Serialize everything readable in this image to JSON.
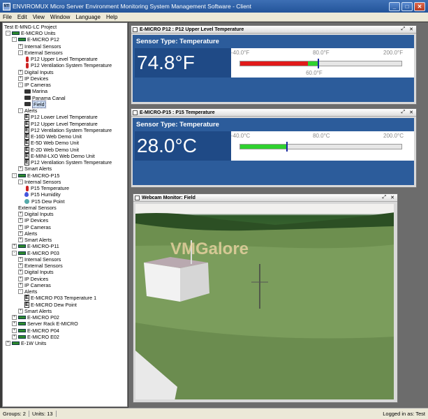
{
  "window": {
    "title": "ENVIROMUX Micro Server Environment Monitoring System Management Software - Client",
    "app_icon": "NTI"
  },
  "menu": [
    "File",
    "Edit",
    "View",
    "Window",
    "Language",
    "Help"
  ],
  "tree": {
    "project": "Test E-MNG-LC Project",
    "rows": [
      {
        "label": "E-MICRO Units",
        "icon": "folder-icon",
        "exp": "-"
      },
      {
        "label": "E-MICRO P12",
        "icon": "unit",
        "exp": "-"
      },
      {
        "label": "Internal Sensors",
        "icon": "",
        "exp": "+"
      },
      {
        "label": "External Sensors",
        "icon": "",
        "exp": "-"
      },
      {
        "label": "P12 Upper Level Temperature",
        "icon": "therm",
        "exp": ""
      },
      {
        "label": "P12 Ventilation System Temperature",
        "icon": "therm",
        "exp": ""
      },
      {
        "label": "Digital Inputs",
        "icon": "",
        "exp": "+"
      },
      {
        "label": "IP Devices",
        "icon": "",
        "exp": "+"
      },
      {
        "label": "IP Cameras",
        "icon": "",
        "exp": "-"
      },
      {
        "label": "Marina",
        "icon": "cam",
        "exp": ""
      },
      {
        "label": "Panama Canal",
        "icon": "cam",
        "exp": ""
      },
      {
        "label": "Field",
        "icon": "cam",
        "exp": "",
        "selected": true
      },
      {
        "label": "Alerts",
        "icon": "",
        "exp": "-"
      },
      {
        "label": "P12 Lower Level Temperature",
        "icon": "alert",
        "exp": ""
      },
      {
        "label": "P12 Upper Level Temperature",
        "icon": "alert",
        "exp": ""
      },
      {
        "label": "P12 Ventilation System Temperature",
        "icon": "alert",
        "exp": ""
      },
      {
        "label": "E-16D Web Demo Unit",
        "icon": "alert",
        "exp": ""
      },
      {
        "label": "E-5D Web Demo Unit",
        "icon": "alert",
        "exp": ""
      },
      {
        "label": "E-2D Web Demo Unit",
        "icon": "alert",
        "exp": ""
      },
      {
        "label": "E-MINI-LXO Web Demo Unit",
        "icon": "alert",
        "exp": ""
      },
      {
        "label": "P12 Ventilation System Temperature",
        "icon": "alert",
        "exp": ""
      },
      {
        "label": "Smart Alerts",
        "icon": "",
        "exp": "+"
      },
      {
        "label": "E-MICRO-P15",
        "icon": "unit",
        "exp": "-"
      },
      {
        "label": "Internal Sensors",
        "icon": "",
        "exp": "-"
      },
      {
        "label": "P15 Temperature",
        "icon": "therm",
        "exp": ""
      },
      {
        "label": "P15 Humidity",
        "icon": "hum",
        "exp": ""
      },
      {
        "label": "P15 Dew Point",
        "icon": "dew",
        "exp": ""
      },
      {
        "label": "External Sensors",
        "icon": "",
        "exp": ""
      },
      {
        "label": "Digital Inputs",
        "icon": "",
        "exp": "+"
      },
      {
        "label": "IP Devices",
        "icon": "",
        "exp": "+"
      },
      {
        "label": "IP Cameras",
        "icon": "",
        "exp": "+"
      },
      {
        "label": "Alerts",
        "icon": "",
        "exp": "+"
      },
      {
        "label": "Smart Alerts",
        "icon": "",
        "exp": "+"
      },
      {
        "label": "E-MICRO-P11",
        "icon": "unit",
        "exp": "+"
      },
      {
        "label": "E-MICRO P03",
        "icon": "unit",
        "exp": "-"
      },
      {
        "label": "Internal Sensors",
        "icon": "",
        "exp": "+"
      },
      {
        "label": "External Sensors",
        "icon": "",
        "exp": "+"
      },
      {
        "label": "Digital Inputs",
        "icon": "",
        "exp": "+"
      },
      {
        "label": "IP Devices",
        "icon": "",
        "exp": "+"
      },
      {
        "label": "IP Cameras",
        "icon": "",
        "exp": "+"
      },
      {
        "label": "Alerts",
        "icon": "",
        "exp": "-"
      },
      {
        "label": "E-MICRO P03 Temperature 1",
        "icon": "alert",
        "exp": ""
      },
      {
        "label": "E-MICRO Dew Point",
        "icon": "alert",
        "exp": ""
      },
      {
        "label": "Smart Alerts",
        "icon": "",
        "exp": "+"
      },
      {
        "label": "E-MICRO P02",
        "icon": "unit",
        "exp": "+"
      },
      {
        "label": "Server Rack E-MICRO",
        "icon": "unit",
        "exp": "+"
      },
      {
        "label": "E-MICRO P04",
        "icon": "unit",
        "exp": "+"
      },
      {
        "label": "E-MICRO E02",
        "icon": "unit",
        "exp": "+"
      },
      {
        "label": "E-1W Units",
        "icon": "unit",
        "exp": "+"
      }
    ]
  },
  "sensor1": {
    "title": "E-MICRO P12 : P12 Upper Level Temperature",
    "type_label": "Sensor Type: Temperature",
    "value": "74.8°F",
    "ticks": [
      "-40.0°F",
      "80.0°F",
      "200.0°F"
    ],
    "setpoint": "60.0°F",
    "scale_min": -40,
    "scale_max": 200,
    "red_to": 60,
    "green_to": 74.8,
    "marker": 80,
    "setpoint_value": 60
  },
  "sensor2": {
    "title": "E-MICRO-P15 : P15 Temperature",
    "type_label": "Sensor Type: Temperature",
    "value": "28.0°C",
    "ticks": [
      "-40.0°C",
      "80.0°C",
      "200.0°C"
    ],
    "scale_min": -40,
    "scale_max": 200,
    "green_to": 28
  },
  "webcam": {
    "title": "Webcam Monitor: Field",
    "watermark": "VMGalore"
  },
  "status": {
    "groups": "Groups: 2",
    "units": "Units: 13",
    "logged": "Logged in as: Test"
  },
  "colors": {
    "red": "#e11a1a",
    "green": "#2fd12f",
    "panel": "#2c5c9b"
  }
}
